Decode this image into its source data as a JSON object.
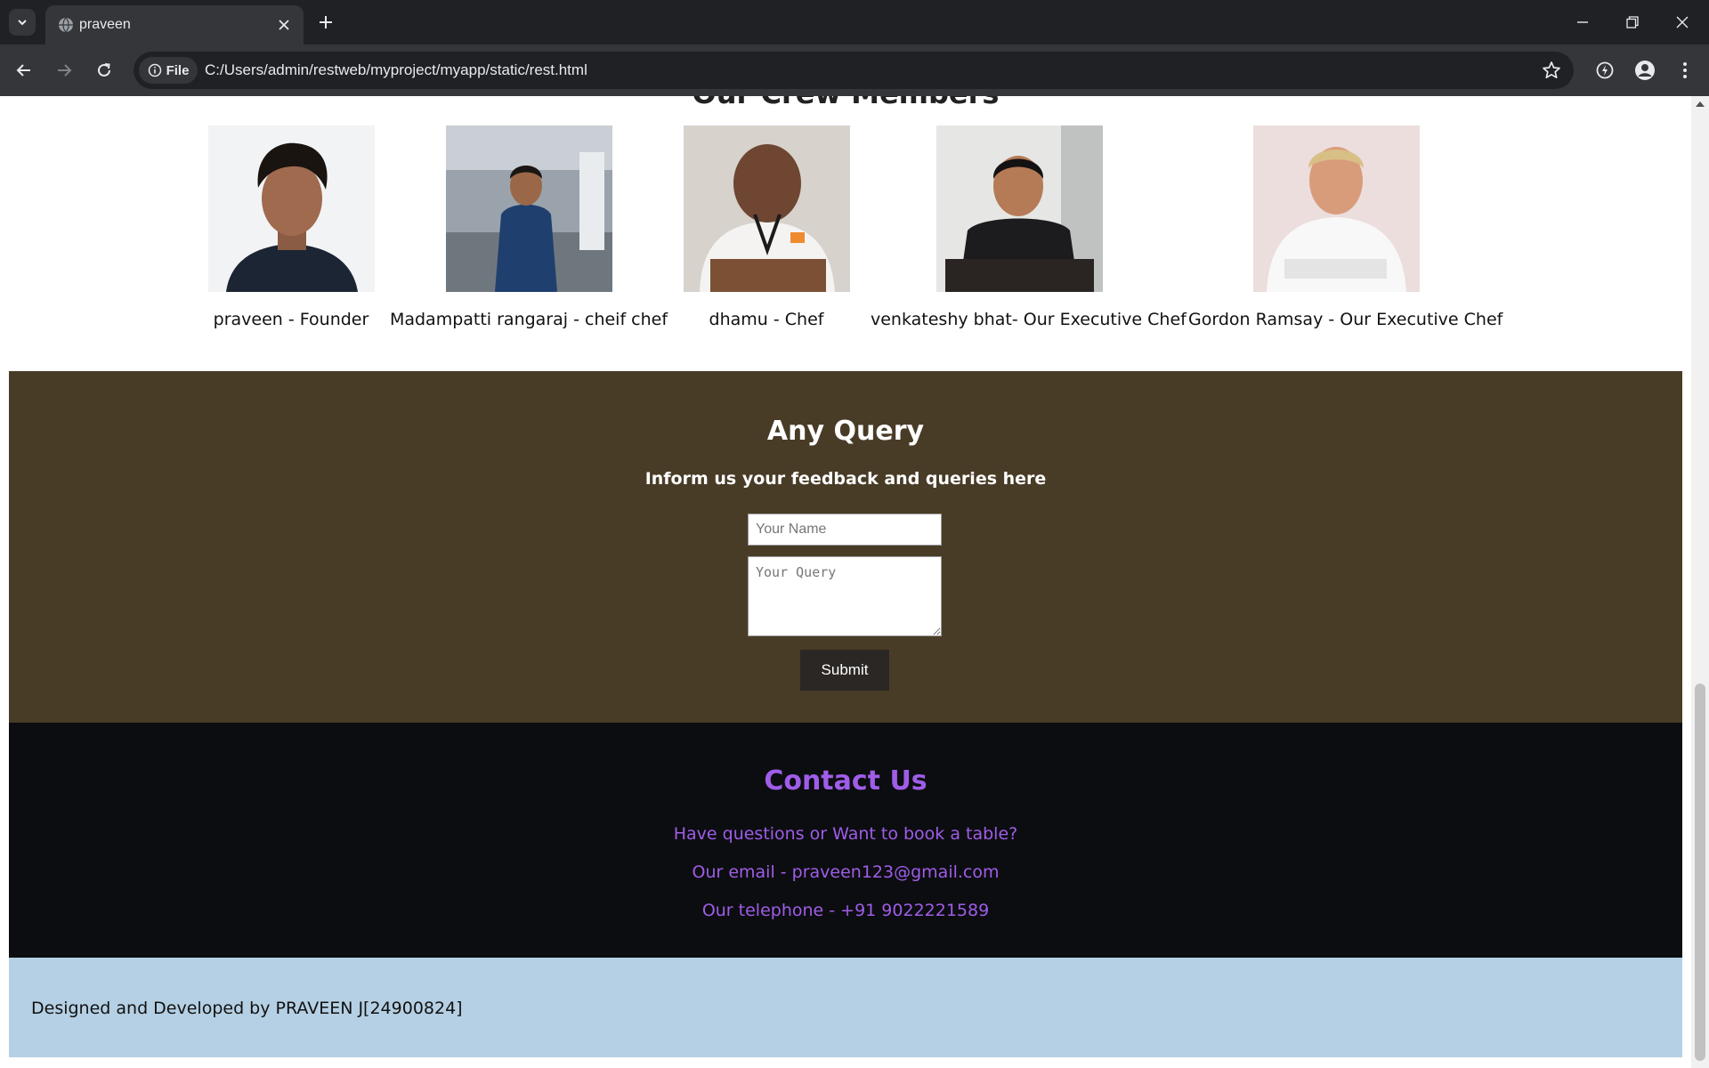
{
  "browser": {
    "tab_title": "praveen",
    "site_chip_label": "File",
    "url": "C:/Users/admin/restweb/myproject/myapp/static/rest.html"
  },
  "crew": {
    "heading": "Our Crew Members",
    "members": [
      {
        "caption": "praveen - Founder"
      },
      {
        "caption": "Madampatti rangaraj - cheif chef"
      },
      {
        "caption": "dhamu - Chef"
      },
      {
        "caption": "venkateshy bhat- Our Executive Chef"
      },
      {
        "caption": "Gordon Ramsay - Our Executive Chef"
      }
    ]
  },
  "query": {
    "title": "Any Query",
    "subtitle": "Inform us your feedback and queries here",
    "name_placeholder": "Your Name",
    "query_placeholder": "Your Query",
    "submit_label": "Submit"
  },
  "contact": {
    "title": "Contact Us",
    "line1": "Have questions or Want to book a table?",
    "line2": "Our email - praveen123@gmail.com",
    "line3": "Our telephone - +91 9022221589",
    "color": "#9f5de8"
  },
  "footer": {
    "text": "Designed and Developed by PRAVEEN J[24900824]"
  }
}
